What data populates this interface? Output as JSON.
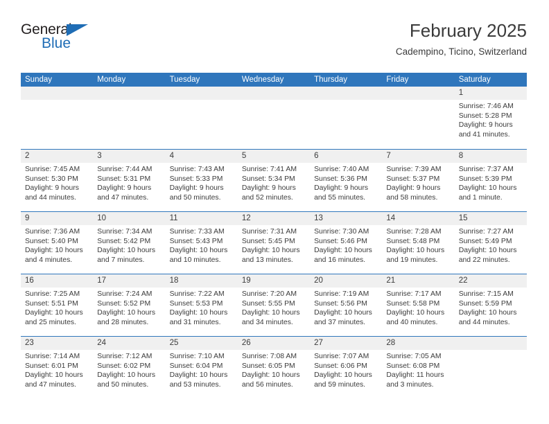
{
  "brand": {
    "name_part1": "General",
    "name_part2": "Blue",
    "triangle_icon": "brand-triangle-icon",
    "accent_color": "#1f6db5"
  },
  "header": {
    "title": "February 2025",
    "subtitle": "Cadempino, Ticino, Switzerland"
  },
  "theme": {
    "header_bg": "#2f76bc",
    "header_text": "#ffffff",
    "daynum_bg": "#f0f0f0",
    "body_text": "#3b3b3b",
    "row_divider": "#2f76bc"
  },
  "weekdays": [
    "Sunday",
    "Monday",
    "Tuesday",
    "Wednesday",
    "Thursday",
    "Friday",
    "Saturday"
  ],
  "weeks": [
    [
      {
        "day": "",
        "sunrise": "",
        "sunset": "",
        "daylight": "",
        "empty": true
      },
      {
        "day": "",
        "sunrise": "",
        "sunset": "",
        "daylight": "",
        "empty": true
      },
      {
        "day": "",
        "sunrise": "",
        "sunset": "",
        "daylight": "",
        "empty": true
      },
      {
        "day": "",
        "sunrise": "",
        "sunset": "",
        "daylight": "",
        "empty": true
      },
      {
        "day": "",
        "sunrise": "",
        "sunset": "",
        "daylight": "",
        "empty": true
      },
      {
        "day": "",
        "sunrise": "",
        "sunset": "",
        "daylight": "",
        "empty": true
      },
      {
        "day": "1",
        "sunrise": "Sunrise: 7:46 AM",
        "sunset": "Sunset: 5:28 PM",
        "daylight": "Daylight: 9 hours and 41 minutes.",
        "empty": false
      }
    ],
    [
      {
        "day": "2",
        "sunrise": "Sunrise: 7:45 AM",
        "sunset": "Sunset: 5:30 PM",
        "daylight": "Daylight: 9 hours and 44 minutes.",
        "empty": false
      },
      {
        "day": "3",
        "sunrise": "Sunrise: 7:44 AM",
        "sunset": "Sunset: 5:31 PM",
        "daylight": "Daylight: 9 hours and 47 minutes.",
        "empty": false
      },
      {
        "day": "4",
        "sunrise": "Sunrise: 7:43 AM",
        "sunset": "Sunset: 5:33 PM",
        "daylight": "Daylight: 9 hours and 50 minutes.",
        "empty": false
      },
      {
        "day": "5",
        "sunrise": "Sunrise: 7:41 AM",
        "sunset": "Sunset: 5:34 PM",
        "daylight": "Daylight: 9 hours and 52 minutes.",
        "empty": false
      },
      {
        "day": "6",
        "sunrise": "Sunrise: 7:40 AM",
        "sunset": "Sunset: 5:36 PM",
        "daylight": "Daylight: 9 hours and 55 minutes.",
        "empty": false
      },
      {
        "day": "7",
        "sunrise": "Sunrise: 7:39 AM",
        "sunset": "Sunset: 5:37 PM",
        "daylight": "Daylight: 9 hours and 58 minutes.",
        "empty": false
      },
      {
        "day": "8",
        "sunrise": "Sunrise: 7:37 AM",
        "sunset": "Sunset: 5:39 PM",
        "daylight": "Daylight: 10 hours and 1 minute.",
        "empty": false
      }
    ],
    [
      {
        "day": "9",
        "sunrise": "Sunrise: 7:36 AM",
        "sunset": "Sunset: 5:40 PM",
        "daylight": "Daylight: 10 hours and 4 minutes.",
        "empty": false
      },
      {
        "day": "10",
        "sunrise": "Sunrise: 7:34 AM",
        "sunset": "Sunset: 5:42 PM",
        "daylight": "Daylight: 10 hours and 7 minutes.",
        "empty": false
      },
      {
        "day": "11",
        "sunrise": "Sunrise: 7:33 AM",
        "sunset": "Sunset: 5:43 PM",
        "daylight": "Daylight: 10 hours and 10 minutes.",
        "empty": false
      },
      {
        "day": "12",
        "sunrise": "Sunrise: 7:31 AM",
        "sunset": "Sunset: 5:45 PM",
        "daylight": "Daylight: 10 hours and 13 minutes.",
        "empty": false
      },
      {
        "day": "13",
        "sunrise": "Sunrise: 7:30 AM",
        "sunset": "Sunset: 5:46 PM",
        "daylight": "Daylight: 10 hours and 16 minutes.",
        "empty": false
      },
      {
        "day": "14",
        "sunrise": "Sunrise: 7:28 AM",
        "sunset": "Sunset: 5:48 PM",
        "daylight": "Daylight: 10 hours and 19 minutes.",
        "empty": false
      },
      {
        "day": "15",
        "sunrise": "Sunrise: 7:27 AM",
        "sunset": "Sunset: 5:49 PM",
        "daylight": "Daylight: 10 hours and 22 minutes.",
        "empty": false
      }
    ],
    [
      {
        "day": "16",
        "sunrise": "Sunrise: 7:25 AM",
        "sunset": "Sunset: 5:51 PM",
        "daylight": "Daylight: 10 hours and 25 minutes.",
        "empty": false
      },
      {
        "day": "17",
        "sunrise": "Sunrise: 7:24 AM",
        "sunset": "Sunset: 5:52 PM",
        "daylight": "Daylight: 10 hours and 28 minutes.",
        "empty": false
      },
      {
        "day": "18",
        "sunrise": "Sunrise: 7:22 AM",
        "sunset": "Sunset: 5:53 PM",
        "daylight": "Daylight: 10 hours and 31 minutes.",
        "empty": false
      },
      {
        "day": "19",
        "sunrise": "Sunrise: 7:20 AM",
        "sunset": "Sunset: 5:55 PM",
        "daylight": "Daylight: 10 hours and 34 minutes.",
        "empty": false
      },
      {
        "day": "20",
        "sunrise": "Sunrise: 7:19 AM",
        "sunset": "Sunset: 5:56 PM",
        "daylight": "Daylight: 10 hours and 37 minutes.",
        "empty": false
      },
      {
        "day": "21",
        "sunrise": "Sunrise: 7:17 AM",
        "sunset": "Sunset: 5:58 PM",
        "daylight": "Daylight: 10 hours and 40 minutes.",
        "empty": false
      },
      {
        "day": "22",
        "sunrise": "Sunrise: 7:15 AM",
        "sunset": "Sunset: 5:59 PM",
        "daylight": "Daylight: 10 hours and 44 minutes.",
        "empty": false
      }
    ],
    [
      {
        "day": "23",
        "sunrise": "Sunrise: 7:14 AM",
        "sunset": "Sunset: 6:01 PM",
        "daylight": "Daylight: 10 hours and 47 minutes.",
        "empty": false
      },
      {
        "day": "24",
        "sunrise": "Sunrise: 7:12 AM",
        "sunset": "Sunset: 6:02 PM",
        "daylight": "Daylight: 10 hours and 50 minutes.",
        "empty": false
      },
      {
        "day": "25",
        "sunrise": "Sunrise: 7:10 AM",
        "sunset": "Sunset: 6:04 PM",
        "daylight": "Daylight: 10 hours and 53 minutes.",
        "empty": false
      },
      {
        "day": "26",
        "sunrise": "Sunrise: 7:08 AM",
        "sunset": "Sunset: 6:05 PM",
        "daylight": "Daylight: 10 hours and 56 minutes.",
        "empty": false
      },
      {
        "day": "27",
        "sunrise": "Sunrise: 7:07 AM",
        "sunset": "Sunset: 6:06 PM",
        "daylight": "Daylight: 10 hours and 59 minutes.",
        "empty": false
      },
      {
        "day": "28",
        "sunrise": "Sunrise: 7:05 AM",
        "sunset": "Sunset: 6:08 PM",
        "daylight": "Daylight: 11 hours and 3 minutes.",
        "empty": false
      },
      {
        "day": "",
        "sunrise": "",
        "sunset": "",
        "daylight": "",
        "empty": true
      }
    ]
  ]
}
